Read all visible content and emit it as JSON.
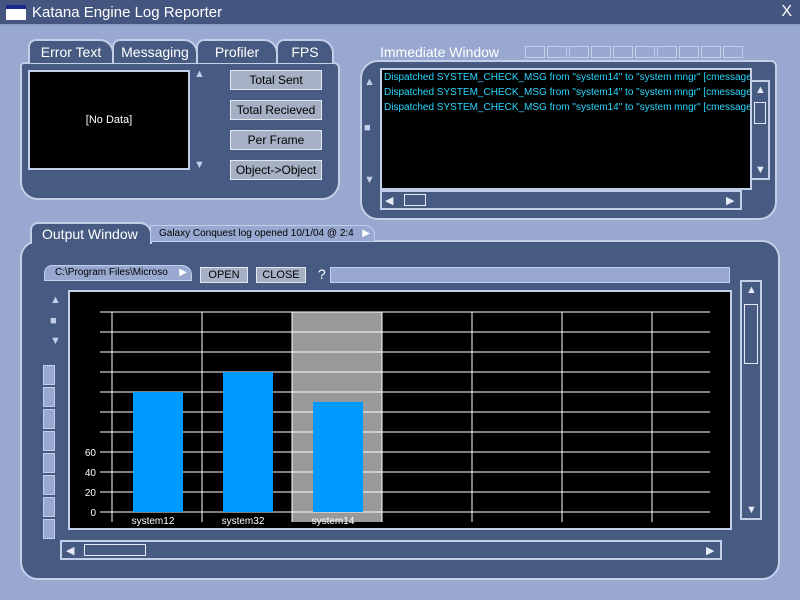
{
  "window": {
    "title": "Katana Engine Log Reporter",
    "close_glyph": "X"
  },
  "top_left": {
    "tabs": [
      {
        "label": "Error Text"
      },
      {
        "label": "Messaging"
      },
      {
        "label": "Profiler"
      },
      {
        "label": "FPS"
      }
    ],
    "active_tab": "Messaging",
    "display_text": "[No Data]",
    "buttons": [
      {
        "label": "Total Sent"
      },
      {
        "label": "Total Recieved"
      },
      {
        "label": "Per Frame"
      },
      {
        "label": "Object->Object"
      }
    ]
  },
  "immediate": {
    "label": "Immediate Window",
    "lines": [
      "Dispatched SYSTEM_CHECK_MSG from \"system14\" to \"system mngr\" [cmessage",
      "Dispatched SYSTEM_CHECK_MSG from \"system14\" to \"system mngr\" [cmessage",
      "Dispatched SYSTEM_CHECK_MSG from \"system14\" to \"system mngr\" [cmessage"
    ]
  },
  "output": {
    "label": "Output Window",
    "subtab": "Galaxy Conquest log opened 10/1/04 @ 2:4",
    "path": "C:\\Program Files\\Microso",
    "open_label": "OPEN",
    "close_label": "CLOSE",
    "help_glyph": "?"
  },
  "icons": {
    "up": "▲",
    "down": "▼",
    "left": "◀",
    "right": "▶",
    "stop": "■"
  },
  "colors": {
    "panel": "#465a82",
    "border": "#c3cfe8",
    "log_text": "#29d8ff",
    "bar": "#0099ff",
    "highlight": "#999999"
  },
  "chart_data": {
    "type": "bar",
    "categories": [
      "system12",
      "system32",
      "system14"
    ],
    "values": [
      120,
      140,
      110
    ],
    "highlighted": "system14",
    "yticks": [
      0,
      20,
      40,
      60
    ],
    "ylim": [
      0,
      200
    ],
    "grid": true
  }
}
